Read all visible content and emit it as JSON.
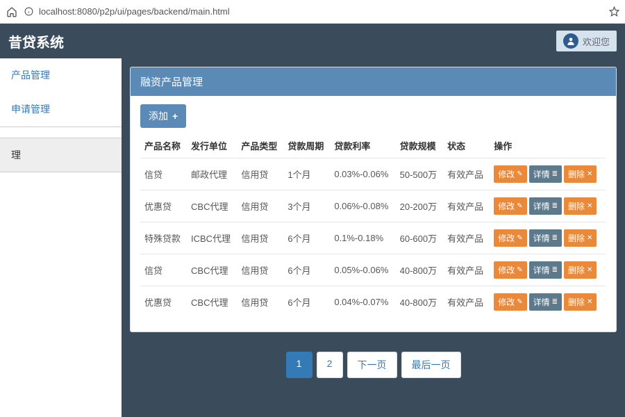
{
  "browser": {
    "url": "localhost:8080/p2p/ui/pages/backend/main.html"
  },
  "header": {
    "brand": "昔贷系统",
    "welcome": "欢迎您"
  },
  "sidebar": {
    "items": [
      {
        "label": "产品管理",
        "selected": false
      },
      {
        "label": "申请管理",
        "selected": false
      },
      {
        "label": "理",
        "selected": true
      }
    ]
  },
  "panel": {
    "title": "融资产品管理",
    "add_label": "添加"
  },
  "table": {
    "headers": [
      "产品名称",
      "发行单位",
      "产品类型",
      "贷款周期",
      "贷款利率",
      "贷款规模",
      "状态",
      "操作"
    ],
    "actions": {
      "edit": "修改",
      "detail": "详情",
      "delete": "删除"
    },
    "rows": [
      {
        "name": "信贷",
        "issuer": "邮政代理",
        "type": "信用贷",
        "period": "1个月",
        "rate": "0.03%-0.06%",
        "scale": "50-500万",
        "status": "有效产品"
      },
      {
        "name": "优惠贷",
        "issuer": "CBC代理",
        "type": "信用贷",
        "period": "3个月",
        "rate": "0.06%-0.08%",
        "scale": "20-200万",
        "status": "有效产品"
      },
      {
        "name": "特殊贷款",
        "issuer": "ICBC代理",
        "type": "信用贷",
        "period": "6个月",
        "rate": "0.1%-0.18%",
        "scale": "60-600万",
        "status": "有效产品"
      },
      {
        "name": "信贷",
        "issuer": "CBC代理",
        "type": "信用贷",
        "period": "6个月",
        "rate": "0.05%-0.06%",
        "scale": "40-800万",
        "status": "有效产品"
      },
      {
        "name": "优惠贷",
        "issuer": "CBC代理",
        "type": "信用贷",
        "period": "6个月",
        "rate": "0.04%-0.07%",
        "scale": "40-800万",
        "status": "有效产品"
      }
    ]
  },
  "pagination": {
    "pages": [
      "1",
      "2"
    ],
    "next": "下一页",
    "last": "最后一页",
    "active_index": 0
  }
}
